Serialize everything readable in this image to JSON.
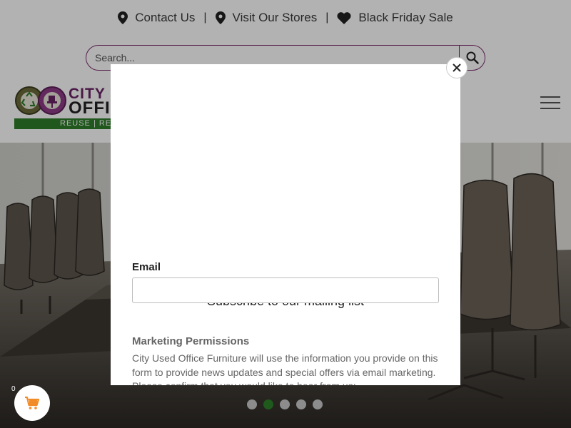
{
  "topbar": {
    "links": [
      {
        "label": "Contact Us",
        "icon": "map-pin-icon"
      },
      {
        "label": "Visit Our Stores",
        "icon": "map-pin-icon"
      },
      {
        "label": "Black Friday Sale",
        "icon": "heart-icon"
      }
    ],
    "separator": "|"
  },
  "search": {
    "placeholder": "Search...",
    "value": "",
    "button_icon": "search-icon"
  },
  "logo": {
    "line1": "CITY U",
    "line2": "OFFIC",
    "tagline": "REUSE | REC"
  },
  "menu": {
    "icon": "hamburger-menu-icon"
  },
  "hero": {
    "slide_count": 5,
    "active_slide": 2
  },
  "cart": {
    "count": "0",
    "icon": "cart-icon"
  },
  "modal": {
    "title": "Subscribe to our mailing list",
    "email_label": "Email",
    "email_value": "",
    "permissions_title": "Marketing Permissions",
    "permissions_text": "City Used Office Furniture will use the information you provide on this form to provide news updates and special offers via email marketing. Please confirm that you would like to hear from us:",
    "close_icon": "close-icon"
  },
  "colors": {
    "brand_purple": "#6b2366",
    "brand_green": "#2f7d2a",
    "active_dot": "#1f5a1c",
    "cart_orange": "#f28c28"
  }
}
